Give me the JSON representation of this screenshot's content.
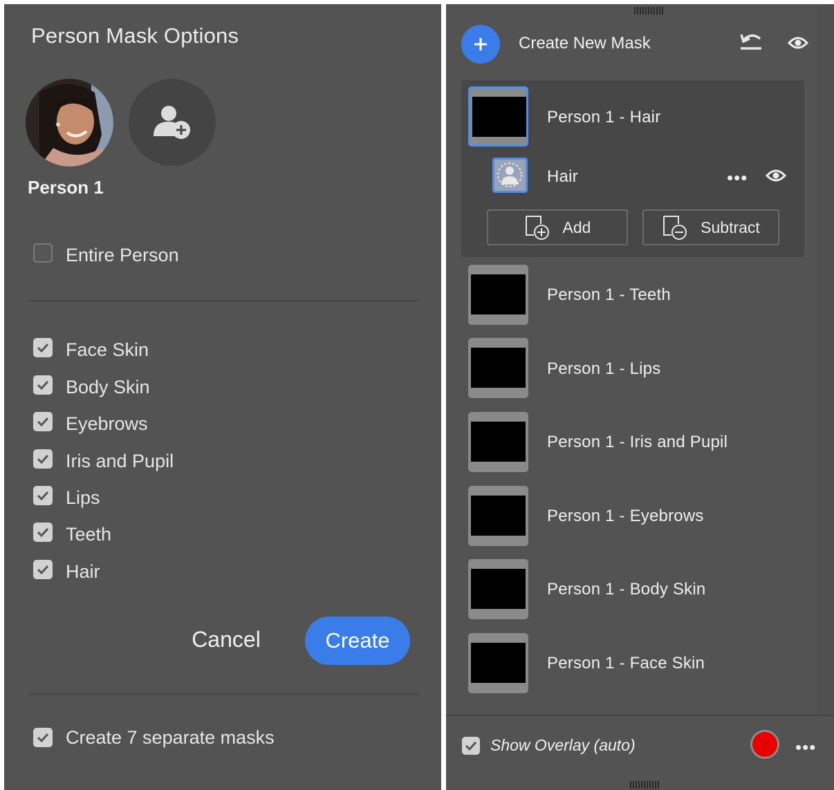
{
  "left_panel": {
    "title": "Person Mask Options",
    "person_name": "Person 1",
    "entire_person": {
      "label": "Entire Person",
      "checked": false
    },
    "options": [
      {
        "label": "Face Skin",
        "checked": true
      },
      {
        "label": "Body Skin",
        "checked": true
      },
      {
        "label": "Eyebrows",
        "checked": true
      },
      {
        "label": "Iris and Pupil",
        "checked": true
      },
      {
        "label": "Lips",
        "checked": true
      },
      {
        "label": "Teeth",
        "checked": true
      },
      {
        "label": "Hair",
        "checked": true
      }
    ],
    "cancel_label": "Cancel",
    "create_label": "Create",
    "separate_masks": {
      "label": "Create 7 separate masks",
      "checked": true
    }
  },
  "right_panel": {
    "header_label": "Create New Mask",
    "active_mask": {
      "label": "Person 1 - Hair",
      "component_label": "Hair",
      "add_label": "Add",
      "subtract_label": "Subtract"
    },
    "masks": [
      {
        "label": "Person 1 - Teeth"
      },
      {
        "label": "Person 1 - Lips"
      },
      {
        "label": "Person 1 - Iris and Pupil"
      },
      {
        "label": "Person 1 - Eyebrows"
      },
      {
        "label": "Person 1 - Body Skin"
      },
      {
        "label": "Person 1 - Face Skin"
      }
    ],
    "show_overlay": {
      "label": "Show Overlay (auto)",
      "checked": true
    },
    "overlay_color": "#e80000",
    "accent_color": "#3b7de8"
  },
  "icons": [
    "add-person-icon",
    "plus-icon",
    "reset-icon",
    "eye-icon",
    "more-icon",
    "add-mask-icon",
    "subtract-mask-icon",
    "person-select-icon",
    "checkmark-icon"
  ]
}
